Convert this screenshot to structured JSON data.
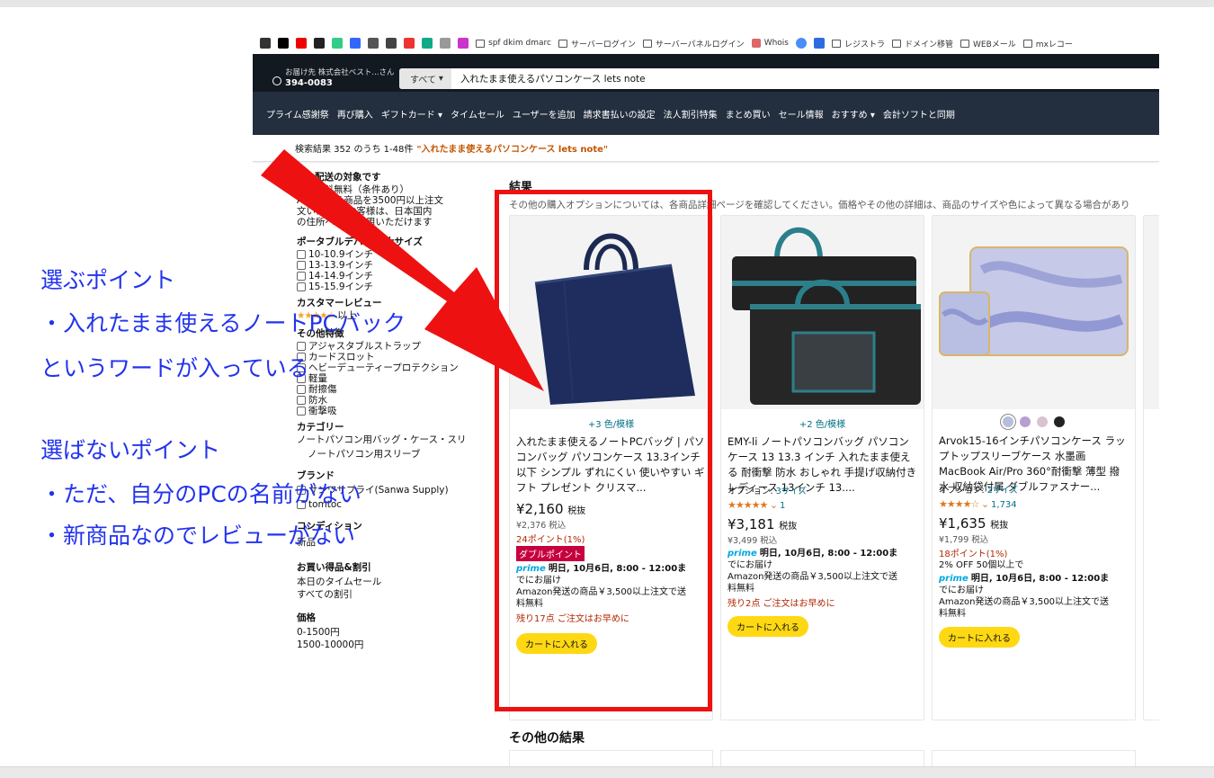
{
  "browser": {
    "bookmarks": [
      "spf dkim dmarc",
      "サーバーログイン",
      "サーバーパネルログイン",
      "Whois",
      "レジストラ",
      "ドメイン移管",
      "WEBメール",
      "mxレコー"
    ]
  },
  "header": {
    "deliver_to": "お届け先 株式会社ベスト...さん",
    "postal_code": "394-0083",
    "search_category": "すべて",
    "search_query": "入れたまま使えるパソコンケース lets note"
  },
  "nav": {
    "items": [
      "プライム感謝祭",
      "再び購入",
      "ギフトカード",
      "タイムセール",
      "ユーザーを追加",
      "請求書払いの設定",
      "法人割引特集",
      "まとめ買い",
      "セール情報",
      "おすすめ",
      "会計ソフトと同期"
    ]
  },
  "result_bar": {
    "count_text": "検索結果 352 のうち 1-48件",
    "query": "\"入れたまま使えるパソコンケース lets note\""
  },
  "sidebar": {
    "delivery_heading": "配送の対象です",
    "delivery_line1": "送料無料（条件あり）",
    "delivery_line2": "Am  送する商品を3500円以上注文",
    "delivery_line3": "文いた  でのお客様は、日本国内",
    "delivery_line4": "の住所へ    をご利用いただけます",
    "size_heading": "ポータブルデバ      の最大サイズ",
    "sizes": [
      "10-10.9インチ",
      "13-13.9インチ",
      "14-14.9インチ",
      "15-15.9インチ"
    ],
    "review_heading": "カスタマーレビュー",
    "review_stars": "★★★★☆",
    "review_label": "以上",
    "features_heading": "その他特徴",
    "features": [
      "アジャスタブルストラップ",
      "カードスロット",
      "ヘビーデューティープロテクション",
      "軽量",
      "耐擦傷",
      "防水",
      "衝撃吸"
    ],
    "category_heading": "カテゴリー",
    "category_1": "ノートパソコン用バッグ・ケース・スリ",
    "category_2": "ノートパソコン用スリーブ",
    "brand_heading": "ブランド",
    "brands": [
      "サンワサプライ(Sanwa Supply)",
      "tomtoc"
    ],
    "condition_heading": "コンディション",
    "condition": "新品",
    "deals_heading": "お買い得品&割引",
    "deals": [
      "本日のタイムセール",
      "すべての割引"
    ],
    "price_heading": "価格",
    "prices": [
      "0-1500円",
      "1500-10000円"
    ]
  },
  "main": {
    "heading": "結果",
    "note": "その他の購入オプションについては、各商品詳細ページを確認してください。価格やその他の詳細は、商品のサイズや色によって異なる場合があり",
    "other_heading": "その他の結果"
  },
  "products": [
    {
      "variants": "+3 色/模様",
      "title": "入れたまま使えるノートPCバッグ | パソコンバッグ パソコンケース 13.3インチ以下 シンプル ずれにくい 使いやすい ギフト プレゼント クリスマ...",
      "price": "¥2,160",
      "tax": "税抜",
      "subprice": "¥2,376 税込",
      "points": "24ポイント(1%)",
      "badge": "ダブルポイント",
      "prime_label": "prime",
      "delivery": "明日, 10月6日, 8:00 - 12:00ま",
      "delivery2": "でにお届け",
      "ship1": "Amazon発送の商品￥3,500以上注文で送",
      "ship2": "料無料",
      "stock": "残り17点 ご注文はお早めに",
      "cart": "カートに入れる"
    },
    {
      "variants": "+2 色/模様",
      "title": "EMY-li ノートパソコンバッグ パソコンケース 13 13.3 インチ 入れたまま使える 耐衝撃 防水 おしゃれ 手提げ収納付き レディース 13インチ 13....",
      "option_label": "オプション:",
      "option_value": "3サイズ",
      "stars": "★★★★★",
      "review_count": "1",
      "price": "¥3,181",
      "tax": "税抜",
      "subprice": "¥3,499 税込",
      "prime_label": "prime",
      "delivery": "明日, 10月6日, 8:00 - 12:00ま",
      "delivery2": "でにお届け",
      "ship1": "Amazon発送の商品￥3,500以上注文で送",
      "ship2": "料無料",
      "stock": "残り2点 ご注文はお早めに",
      "cart": "カートに入れる"
    },
    {
      "title": "Arvok15-16インチパソコンケース ラップトップスリーブケース 水墨画 MacBook Air/Pro 360°耐衝撃 薄型 撥水 収納袋付属 ダブルファスナー...",
      "option_label": "オプション:",
      "option_value": "2サイズ",
      "stars": "★★★★☆",
      "review_count": "1,734",
      "price": "¥1,635",
      "tax": "税抜",
      "subprice": "¥1,799 税込",
      "points": "18ポイント(1%)",
      "discount": "2% OFF 50個以上で",
      "prime_label": "prime",
      "delivery": "明日, 10月6日, 8:00 - 12:00ま",
      "delivery2": "でにお届け",
      "ship1": "Amazon発送の商品￥3,500以上注文で送",
      "ship2": "料無料",
      "cart": "カートに入れる",
      "swatch_colors": [
        "#b7bedc",
        "#b79fcf",
        "#d8c3d0",
        "#222222"
      ]
    }
  ],
  "annotations": {
    "line1": "選ぶポイント",
    "line2": "・入れたまま使えるノートPCバック",
    "line3": "というワードが入っている",
    "line4": "選ばないポイント",
    "line5": "・ただ、自分のPCの名前がない",
    "line6": "・新商品なのでレビューがない"
  },
  "colors": {
    "annotation_text": "#2233ee",
    "highlight": "#ee1111",
    "amazon_header": "#131921",
    "amazon_nav": "#232f3e",
    "cart_button": "#ffd814"
  }
}
